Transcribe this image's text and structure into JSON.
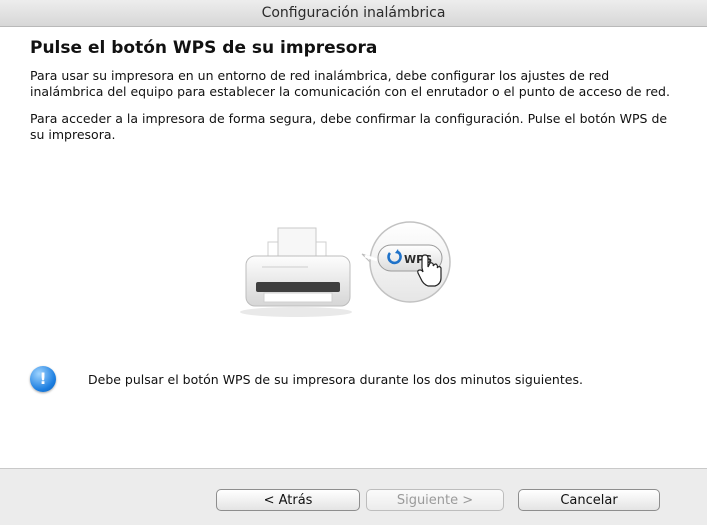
{
  "window": {
    "title": "Configuración inalámbrica"
  },
  "main": {
    "heading": "Pulse el botón WPS de su impresora",
    "paragraph1": "Para usar su impresora en un entorno de red inalámbrica, debe configurar los ajustes de red inalámbrica del equipo para establecer la comunicación con el enrutador o el punto de acceso de red.",
    "paragraph2": "Para acceder a la impresora de forma segura, debe confirmar la configuración. Pulse el botón WPS de su impresora.",
    "illustration": {
      "wps_label": "WPS"
    },
    "notice": {
      "icon": "info-icon",
      "icon_glyph": "!",
      "text": "Debe pulsar el botón WPS de su impresora durante los dos minutos siguientes."
    }
  },
  "footer": {
    "back_label": "< Atrás",
    "next_label": "Siguiente >",
    "cancel_label": "Cancelar"
  }
}
